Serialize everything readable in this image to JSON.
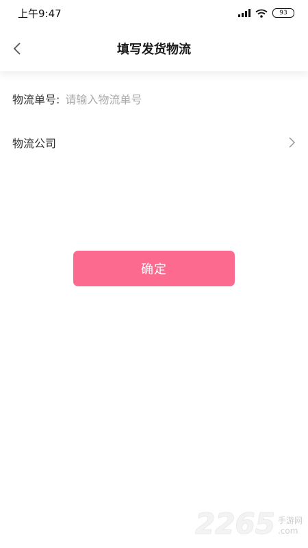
{
  "status_bar": {
    "time": "上午9:47",
    "battery": "93"
  },
  "nav": {
    "title": "填写发货物流"
  },
  "form": {
    "tracking_label": "物流单号:",
    "tracking_placeholder": "请输入物流单号",
    "company_label": "物流公司"
  },
  "actions": {
    "confirm_label": "确定"
  },
  "watermark": {
    "number": "2265",
    "site_name": "手游网",
    "domain": ".com"
  },
  "colors": {
    "accent": "#fc6a8f"
  }
}
